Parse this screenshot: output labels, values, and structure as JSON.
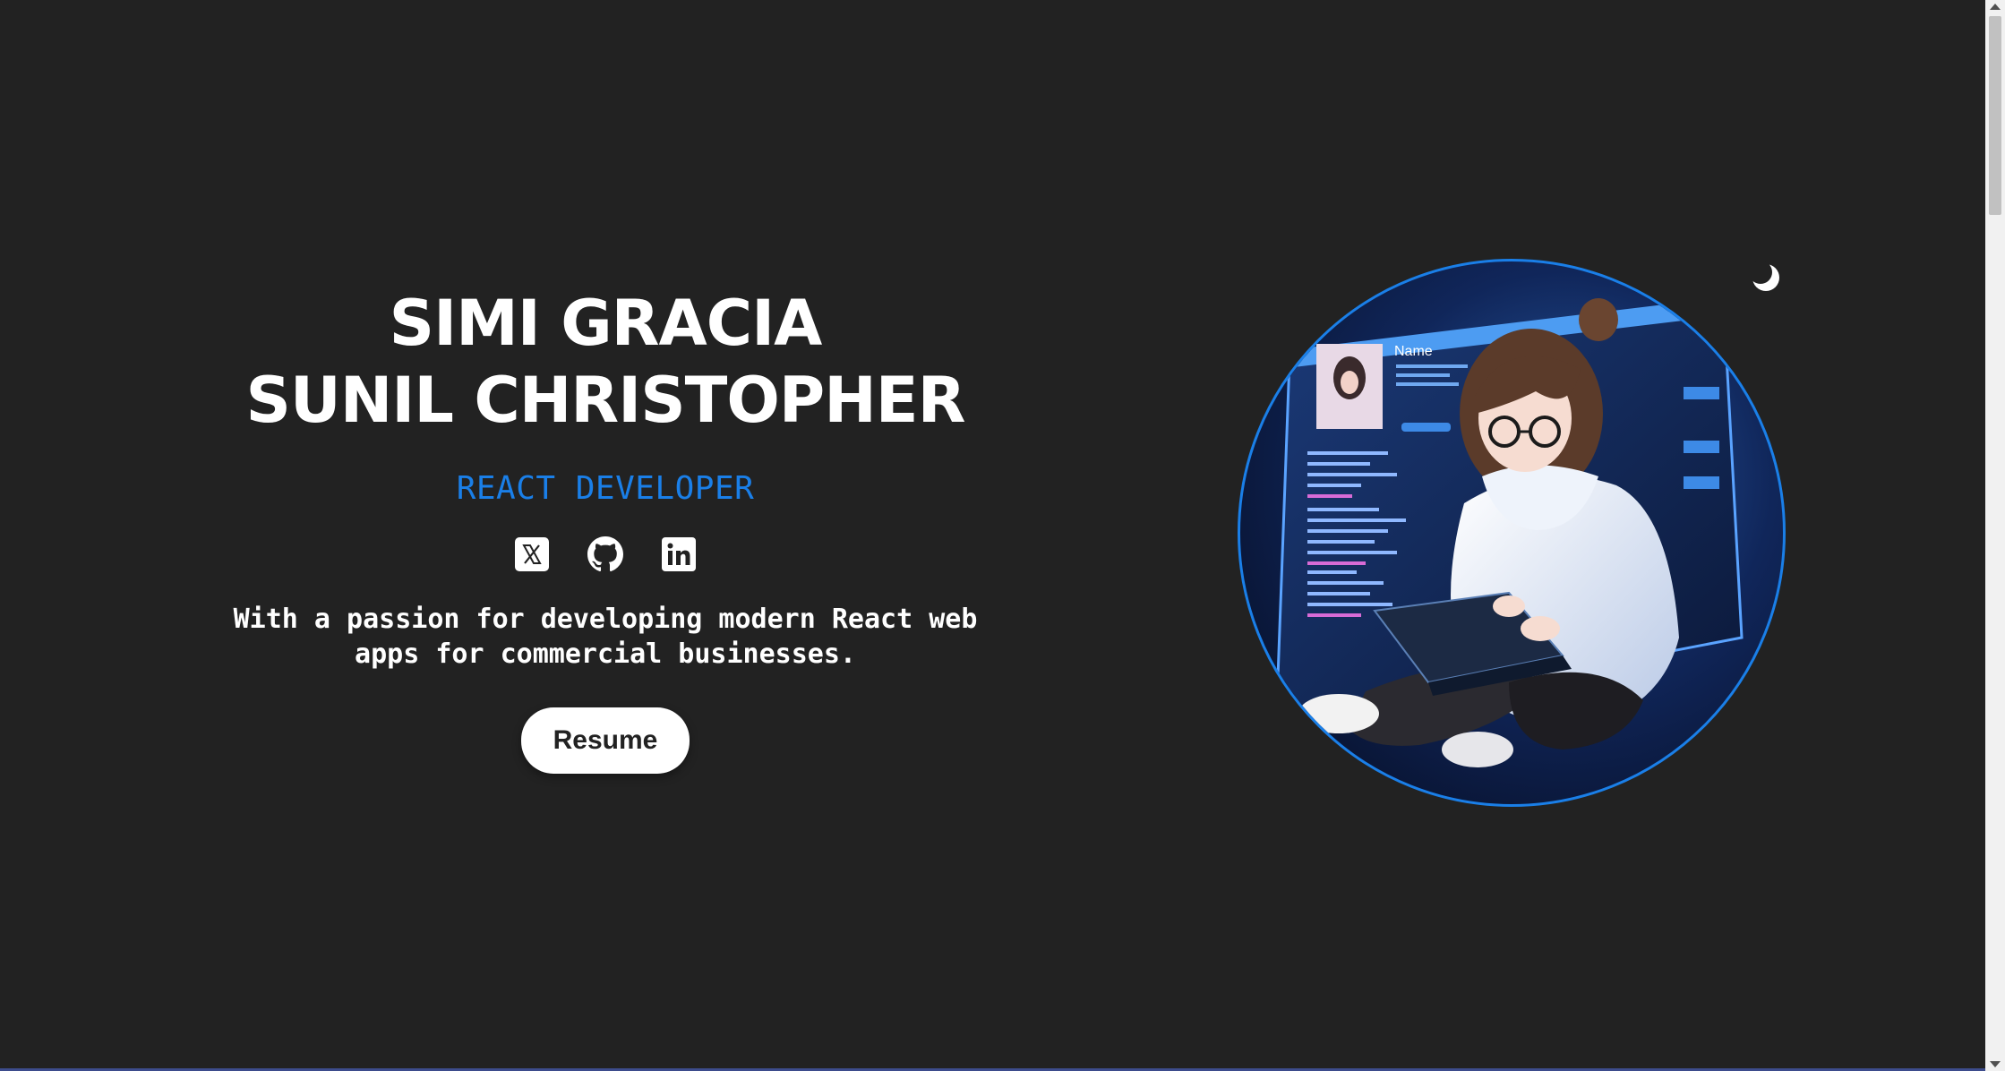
{
  "hero": {
    "name_line1": "SIMI GRACIA",
    "name_line2": "SUNIL CHRISTOPHER",
    "role": "REACT DEVELOPER",
    "tagline": "With a passion for developing modern React web apps for commercial businesses.",
    "resume_label": "Resume"
  },
  "socials": [
    {
      "icon": "x-twitter-icon"
    },
    {
      "icon": "github-icon"
    },
    {
      "icon": "linkedin-icon"
    }
  ],
  "avatar": {
    "screen_label": "Name",
    "description_icon": "developer-avatar-illustration"
  },
  "theme_toggle": {
    "icon": "moon-icon"
  },
  "colors": {
    "background": "#222222",
    "accent": "#1a7fe8",
    "text": "#ffffff",
    "button_bg": "#ffffff"
  }
}
